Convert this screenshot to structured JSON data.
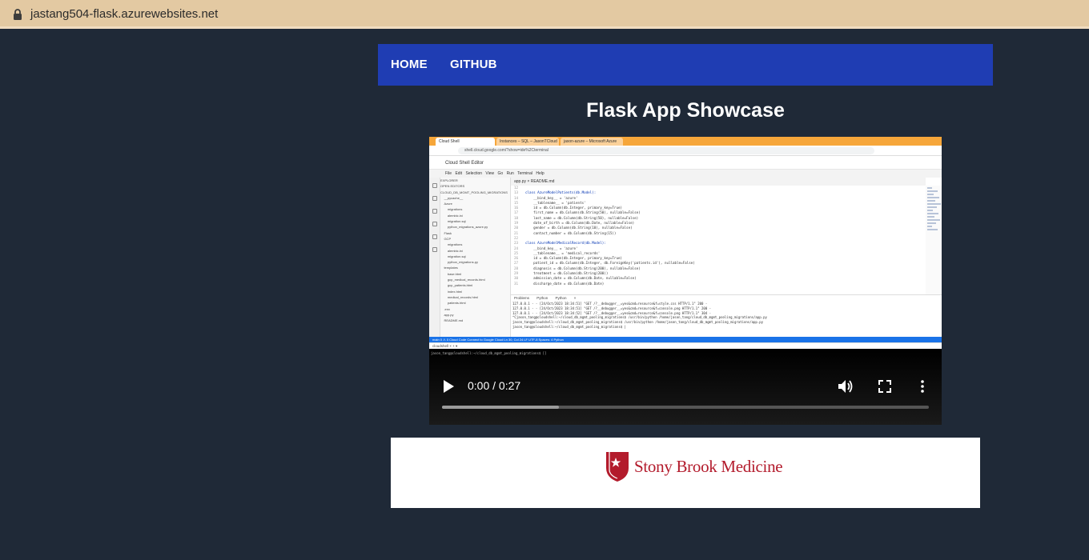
{
  "browser": {
    "url": "jastang504-flask.azurewebsites.net",
    "lock_icon": "lock-icon"
  },
  "nav": {
    "home": "HOME",
    "github": "GITHUB"
  },
  "page": {
    "title": "Flask App Showcase"
  },
  "video": {
    "time": "0:00 / 0:27",
    "buffered_fraction": 0.24,
    "icons": [
      "play-icon",
      "volume-icon",
      "fullscreen-icon",
      "more-options-icon"
    ],
    "frame": {
      "tabs": [
        "Cloud Shell",
        "Instances – SQL – JasonTCloud",
        "jason-azure – Microsoft Azure"
      ],
      "address": "shell.cloud.google.com/?show=ide%2Cterminal",
      "app_title": "Cloud Shell Editor",
      "menu": "File  Edit  Selection  View  Go  Run  Terminal  Help",
      "editor_tabs": "app.py  ×    README.md",
      "explorer": [
        "EXPLORER",
        "OPEN EDITORS",
        "CLOUD_DB_MGMT_POOLING_MIGRATIONS",
        "  __pycache__",
        "  Azure",
        "    migrations",
        "    alembic.ini",
        "    migration.sql",
        "    python_migrations_azure.py",
        "  Flask",
        "  GCP",
        "    migrations",
        "    alembic.ini",
        "    migration.sql",
        "    python_migrations.py",
        "  templates",
        "    base.html",
        "    gcp_medical_records.html",
        "    gcp_patients.html",
        "    index.html",
        "    medical_records.html",
        "    patients.html",
        "  .env",
        "  app.py",
        "  README.md"
      ],
      "code": [
        {
          "n": "12",
          "t": ""
        },
        {
          "n": "13",
          "t": "class AzureModelPatients(db.Model):"
        },
        {
          "n": "14",
          "t": "    __bind_key__ = 'azure'"
        },
        {
          "n": "15",
          "t": "    __tablename__ = 'patients'"
        },
        {
          "n": "16",
          "t": "    id = db.Column(db.Integer, primary_key=True)"
        },
        {
          "n": "17",
          "t": "    first_name = db.Column(db.String(50), nullable=False)"
        },
        {
          "n": "18",
          "t": "    last_name = db.Column(db.String(50), nullable=False)"
        },
        {
          "n": "19",
          "t": "    date_of_birth = db.Column(db.Date, nullable=False)"
        },
        {
          "n": "20",
          "t": "    gender = db.Column(db.String(10), nullable=False)"
        },
        {
          "n": "21",
          "t": "    contact_number = db.Column(db.String(15))"
        },
        {
          "n": "22",
          "t": ""
        },
        {
          "n": "23",
          "t": "class AzureModelMedicalRecord(db.Model):"
        },
        {
          "n": "24",
          "t": "    __bind_key__ = 'azure'"
        },
        {
          "n": "25",
          "t": "    __tablename__ = 'medical_records'"
        },
        {
          "n": "26",
          "t": "    id = db.Column(db.Integer, primary_key=True)"
        },
        {
          "n": "27",
          "t": "    patient_id = db.Column(db.Integer, db.ForeignKey('patients.id'), nullable=False)"
        },
        {
          "n": "28",
          "t": "    diagnosis = db.Column(db.String(200), nullable=False)"
        },
        {
          "n": "29",
          "t": "    treatment = db.Column(db.String(200))"
        },
        {
          "n": "30",
          "t": "    admission_date = db.Column(db.Date, nullable=False)"
        },
        {
          "n": "31",
          "t": "    discharge_date = db.Column(db.Date)"
        }
      ],
      "panel_tabs": "Problems   Python   Python ×",
      "terminal": [
        "127.0.0.1 - - [24/Oct/2023 18:34:51] \"GET /?__debugger__=yes&cmd=resource&f=style.css HTTP/1.1\" 200 -",
        "127.0.0.1 - - [24/Oct/2023 18:34:51] \"GET /?__debugger__=yes&cmd=resource&f=console.png HTTP/1.1\" 200 -",
        "127.0.0.1 - - [24/Oct/2023 18:34:52] \"GET /?__debugger__=yes&cmd=resource&f=console.png HTTP/1.1\" 304 -",
        "^Cjason_tang@cloudshell:~/cloud_db_mgmt_pooling_migrations$ /usr/bin/python /home/jason_tang/cloud_db_mgmt_pooling_migrations/app.py",
        "jason_tang@cloudshell:~/cloud_db_mgmt_pooling_migrations$ /usr/bin/python /home/jason_tang/cloud_db_mgmt_pooling_migrations/app.py",
        "jason_tang@cloudshell:~/cloud_db_mgmt_pooling_migrations$ |"
      ],
      "status": "main   0 ⚠ 0   Cloud Code   Connect to Google Cloud                                          Ln 30, Col 24   LF   UTF-8   Spaces: 4   Python",
      "term2_tab": "cloudshell ×   +  ▾",
      "term2_line": "jason_tang@cloudshell:~/cloud_db_mgmt_pooling_migrations$ []"
    }
  },
  "logo": {
    "text": "Stony Brook Medicine",
    "mark_icon": "stony-brook-shield-icon",
    "color": "#b31b2c"
  },
  "colors": {
    "background": "#1f2937",
    "navbar": "#1f3db3",
    "urlbar": "#e3c9a2"
  }
}
